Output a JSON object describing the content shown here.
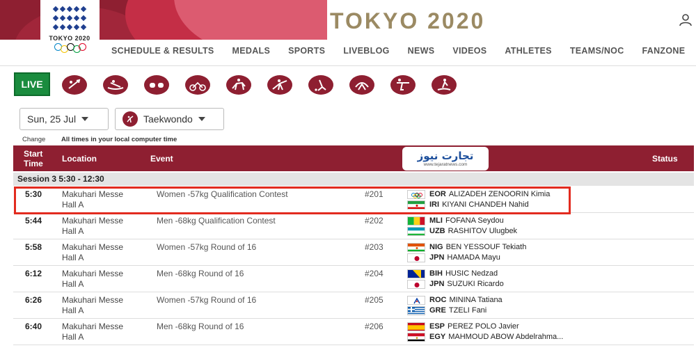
{
  "header": {
    "brand_title": "TOKYO 2020",
    "logo_text": "TOKYO 2020",
    "nav": [
      "SCHEDULE & RESULTS",
      "MEDALS",
      "SPORTS",
      "LIVEBLOG",
      "NEWS",
      "VIDEOS",
      "ATHLETES",
      "TEAMS/NOC",
      "FANZONE"
    ],
    "colors": {
      "primary": "#8e1f31",
      "brand_gold": "#9b8a63",
      "live_green": "#1a8c3e"
    }
  },
  "sports_bar": {
    "live_label": "LIVE",
    "icons": [
      "archery-icon",
      "rowing-icon",
      "boxing-icon",
      "cycling-icon",
      "equestrian-icon",
      "fencing-icon",
      "hockey-icon",
      "judo-icon",
      "shooting-icon",
      "surfing-icon"
    ]
  },
  "filters": {
    "date": "Sun, 25 Jul",
    "sport": "Taekwondo",
    "change_label": "Change",
    "times_note": "All times in your local computer time"
  },
  "table": {
    "headers": {
      "start_time": "Start Time",
      "location": "Location",
      "event": "Event",
      "status": "Status"
    },
    "session": "Session 3  5:30 - 12:30",
    "rows": [
      {
        "time": "5:30",
        "loc1": "Makuhari Messe",
        "loc2": "Hall A",
        "event": "Women -57kg Qualification Contest",
        "num": "#201",
        "a1": {
          "noc": "EOR",
          "name": "ALIZADEH ZENOORIN Kimia",
          "flag": "eor"
        },
        "a2": {
          "noc": "IRI",
          "name": "KIYANI CHANDEH Nahid",
          "flag": "iri"
        }
      },
      {
        "time": "5:44",
        "loc1": "Makuhari Messe",
        "loc2": "Hall A",
        "event": "Men -68kg Qualification Contest",
        "num": "#202",
        "a1": {
          "noc": "MLI",
          "name": "FOFANA Seydou",
          "flag": "mli"
        },
        "a2": {
          "noc": "UZB",
          "name": "RASHITOV Ulugbek",
          "flag": "uzb"
        }
      },
      {
        "time": "5:58",
        "loc1": "Makuhari Messe",
        "loc2": "Hall A",
        "event": "Women -57kg Round of 16",
        "num": "#203",
        "a1": {
          "noc": "NIG",
          "name": "BEN YESSOUF Tekiath",
          "flag": "nig"
        },
        "a2": {
          "noc": "JPN",
          "name": "HAMADA Mayu",
          "flag": "jpn"
        }
      },
      {
        "time": "6:12",
        "loc1": "Makuhari Messe",
        "loc2": "Hall A",
        "event": "Men -68kg Round of 16",
        "num": "#204",
        "a1": {
          "noc": "BIH",
          "name": "HUSIC Nedzad",
          "flag": "bih"
        },
        "a2": {
          "noc": "JPN",
          "name": "SUZUKI Ricardo",
          "flag": "jpn"
        }
      },
      {
        "time": "6:26",
        "loc1": "Makuhari Messe",
        "loc2": "Hall A",
        "event": "Women -57kg Round of 16",
        "num": "#205",
        "a1": {
          "noc": "ROC",
          "name": "MININA Tatiana",
          "flag": "roc"
        },
        "a2": {
          "noc": "GRE",
          "name": "TZELI Fani",
          "flag": "gre"
        }
      },
      {
        "time": "6:40",
        "loc1": "Makuhari Messe",
        "loc2": "Hall A",
        "event": "Men -68kg Round of 16",
        "num": "#206",
        "a1": {
          "noc": "ESP",
          "name": "PEREZ POLO Javier",
          "flag": "esp"
        },
        "a2": {
          "noc": "EGY",
          "name": "MAHMOUD ABOW Abdelrahma...",
          "flag": "egy"
        }
      }
    ]
  },
  "watermark": {
    "main": "تجارت نیوز",
    "sub": "www.tejaratnews.com"
  }
}
